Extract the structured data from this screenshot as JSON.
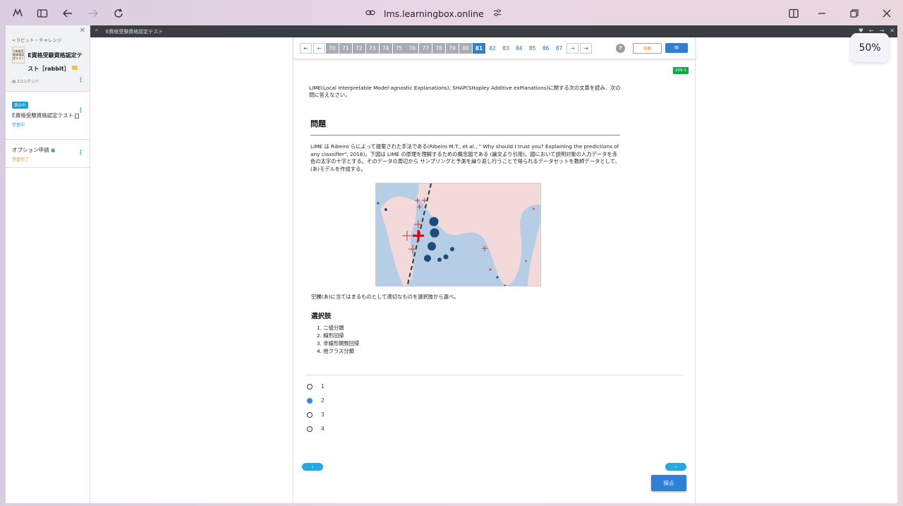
{
  "browser": {
    "url": "lms.learningbox.online",
    "zoom": "50%"
  },
  "sidebar": {
    "breadcrumb": "<ラビット・チャレンジ",
    "course_thumb_text": "E資格受験資格認定テスト",
    "course_title": "E資格受験資格認定テスト［rabbit］",
    "content_count": "2コンテンツ",
    "items": [
      {
        "badge": "表示中",
        "title": "E資格受験資格認定テスト",
        "status": "学習中"
      },
      {
        "title": "オプション申請",
        "status": "学習完了"
      }
    ]
  },
  "topbar": {
    "title": "E資格受験資格認定テスト"
  },
  "pager": {
    "first": "⇤",
    "prev": "←",
    "next": "→",
    "last": "⇥",
    "pages_done": [
      "70",
      "71",
      "72",
      "73",
      "74",
      "75",
      "76",
      "77",
      "78",
      "79",
      "80"
    ],
    "page_current": "81",
    "pages_todo": [
      "82",
      "83",
      "84",
      "85",
      "86",
      "87"
    ],
    "help": "?",
    "suspend_label": "中断",
    "menu_label": "≡"
  },
  "question": {
    "id": "205-1",
    "intro": "LIME(Local Interpretable Model-agnostic Explanations), SHAP(SHapley Additive exPlanations)に関する次の文章を読み、次の問に答えなさい。",
    "heading": "問題",
    "body": "LIME は Ribeiro らによって提案された手法である(Ribeiro M.T., et al., \" Why should I trust you? Explaining the predictions of any classifier\", 2016)。下図は LIME の原理を理解するための概念図である (論文より引用)。図において説明対象の入力データを赤色の太字の十字とする。そのデータの周辺から サンプリングと予測を繰り返し行うことで得られるデータセットを教師データとして、(あ)モデルを作成する。",
    "prompt": "空欄(あ)に当てはまるものとして適切なものを選択肢から選べ。",
    "choices_heading": "選択肢",
    "choices": [
      "1. 二値分類",
      "2. 線形回帰",
      "3. 非線形関数回帰",
      "4. 他クラス分類"
    ],
    "answers": [
      "1",
      "2",
      "3",
      "4"
    ],
    "selected": "2",
    "prev_label": "‹",
    "next_label": "›",
    "grade_label": "採点"
  },
  "colors": {
    "accent": "#2f7fd6",
    "cyan": "#29a8e0",
    "orange": "#f08a24",
    "green": "#17a34a",
    "figure_blue": "#b6cde6",
    "figure_pink": "#f3d9d9"
  }
}
